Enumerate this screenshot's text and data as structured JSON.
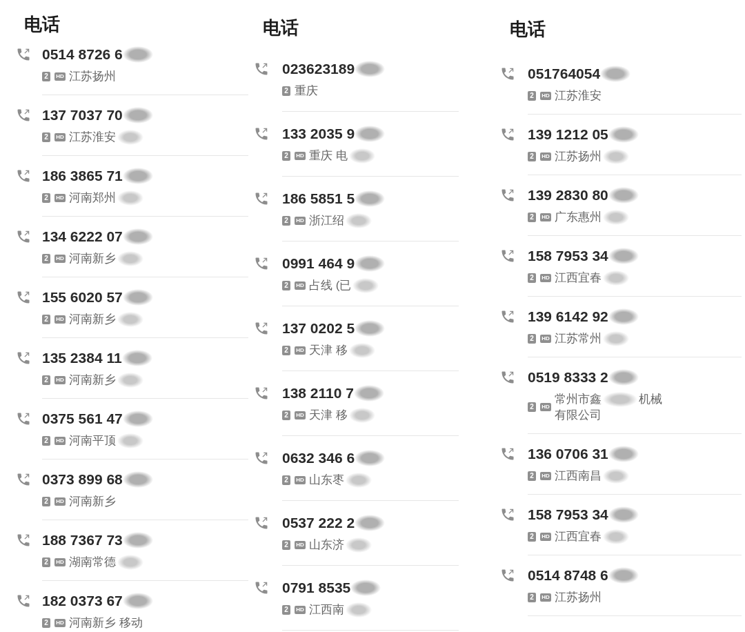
{
  "screens": [
    {
      "title": "电话",
      "calls": [
        {
          "number": "0514 8726 6",
          "number_blurred": true,
          "badges": [
            {
              "kind": "sim",
              "text": "2"
            },
            {
              "kind": "hd",
              "text": "HD"
            }
          ],
          "location": [
            [
              "江苏扬州"
            ]
          ],
          "location_blurred": false
        },
        {
          "number": "137 7037 70",
          "number_blurred": true,
          "badges": [
            {
              "kind": "sim",
              "text": "2"
            },
            {
              "kind": "hd",
              "text": "HD"
            }
          ],
          "location": [
            [
              "江苏淮安"
            ]
          ],
          "location_blurred": true
        },
        {
          "number": "186 3865 71",
          "number_blurred": true,
          "badges": [
            {
              "kind": "sim",
              "text": "2"
            },
            {
              "kind": "hd",
              "text": "HD"
            }
          ],
          "location": [
            [
              "河南郑州"
            ]
          ],
          "location_blurred": true
        },
        {
          "number": "134 6222 07",
          "number_blurred": true,
          "badges": [
            {
              "kind": "sim",
              "text": "2"
            },
            {
              "kind": "hd",
              "text": "HD"
            }
          ],
          "location": [
            [
              "河南新乡"
            ]
          ],
          "location_blurred": true
        },
        {
          "number": "155 6020 57",
          "number_blurred": true,
          "badges": [
            {
              "kind": "sim",
              "text": "2"
            },
            {
              "kind": "hd",
              "text": "HD"
            }
          ],
          "location": [
            [
              "河南新乡"
            ]
          ],
          "location_blurred": true
        },
        {
          "number": "135 2384 11",
          "number_blurred": true,
          "badges": [
            {
              "kind": "sim",
              "text": "2"
            },
            {
              "kind": "hd",
              "text": "HD"
            }
          ],
          "location": [
            [
              "河南新乡"
            ]
          ],
          "location_blurred": true
        },
        {
          "number": "0375 561 47",
          "number_blurred": true,
          "badges": [
            {
              "kind": "sim",
              "text": "2"
            },
            {
              "kind": "hd",
              "text": "HD"
            }
          ],
          "location": [
            [
              "河南平顶"
            ]
          ],
          "location_blurred": true
        },
        {
          "number": "0373 899 68",
          "number_blurred": true,
          "badges": [
            {
              "kind": "sim",
              "text": "2"
            },
            {
              "kind": "hd",
              "text": "HD"
            }
          ],
          "location": [
            [
              "河南新乡"
            ]
          ],
          "location_blurred": false
        },
        {
          "number": "188 7367 73",
          "number_blurred": true,
          "badges": [
            {
              "kind": "sim",
              "text": "2"
            },
            {
              "kind": "hd",
              "text": "HD"
            }
          ],
          "location": [
            [
              "湖南常德"
            ]
          ],
          "location_blurred": true
        },
        {
          "number": "182 0373 67",
          "number_blurred": true,
          "badges": [
            {
              "kind": "sim",
              "text": "2"
            },
            {
              "kind": "hd",
              "text": "HD"
            }
          ],
          "location": [
            [
              "河南新乡 移动"
            ]
          ],
          "location_blurred": false
        }
      ]
    },
    {
      "title": "电话",
      "calls": [
        {
          "number": "023623189",
          "number_blurred": true,
          "badges": [
            {
              "kind": "sim",
              "text": "2"
            }
          ],
          "location": [
            [
              "重庆"
            ]
          ],
          "location_blurred": false
        },
        {
          "number": "133 2035 9",
          "number_blurred": true,
          "badges": [
            {
              "kind": "sim",
              "text": "2"
            },
            {
              "kind": "hd",
              "text": "HD"
            }
          ],
          "location": [
            [
              "重庆 电"
            ]
          ],
          "location_blurred": true
        },
        {
          "number": "186 5851 5",
          "number_blurred": true,
          "badges": [
            {
              "kind": "sim",
              "text": "2"
            },
            {
              "kind": "hd",
              "text": "HD"
            }
          ],
          "location": [
            [
              "浙江绍"
            ]
          ],
          "location_blurred": true
        },
        {
          "number": "0991 464 9",
          "number_blurred": true,
          "badges": [
            {
              "kind": "sim",
              "text": "2"
            },
            {
              "kind": "hd",
              "text": "HD"
            }
          ],
          "location": [
            [
              "占线 (已"
            ]
          ],
          "location_blurred": true
        },
        {
          "number": "137 0202 5",
          "number_blurred": true,
          "badges": [
            {
              "kind": "sim",
              "text": "2"
            },
            {
              "kind": "hd",
              "text": "HD"
            }
          ],
          "location": [
            [
              "天津 移"
            ]
          ],
          "location_blurred": true
        },
        {
          "number": "138 2110 7",
          "number_blurred": true,
          "badges": [
            {
              "kind": "sim",
              "text": "2"
            },
            {
              "kind": "hd",
              "text": "HD"
            }
          ],
          "location": [
            [
              "天津 移"
            ]
          ],
          "location_blurred": true
        },
        {
          "number": "0632 346 6",
          "number_blurred": true,
          "badges": [
            {
              "kind": "sim",
              "text": "2"
            },
            {
              "kind": "hd",
              "text": "HD"
            }
          ],
          "location": [
            [
              "山东枣"
            ]
          ],
          "location_blurred": true
        },
        {
          "number": "0537 222 2",
          "number_blurred": true,
          "badges": [
            {
              "kind": "sim",
              "text": "2"
            },
            {
              "kind": "hd",
              "text": "HD"
            }
          ],
          "location": [
            [
              "山东济"
            ]
          ],
          "location_blurred": true
        },
        {
          "number": "0791 8535",
          "number_blurred": true,
          "badges": [
            {
              "kind": "sim",
              "text": "2"
            },
            {
              "kind": "hd",
              "text": "HD"
            }
          ],
          "location": [
            [
              "江西南"
            ]
          ],
          "location_blurred": true
        }
      ]
    },
    {
      "title": "电话",
      "calls": [
        {
          "number": "051764054",
          "number_blurred": true,
          "badges": [
            {
              "kind": "sim",
              "text": "2"
            },
            {
              "kind": "hd",
              "text": "HD"
            }
          ],
          "location": [
            [
              "江苏淮安"
            ]
          ],
          "location_blurred": false
        },
        {
          "number": "139 1212 05",
          "number_blurred": true,
          "badges": [
            {
              "kind": "sim",
              "text": "2"
            },
            {
              "kind": "hd",
              "text": "HD"
            }
          ],
          "location": [
            [
              "江苏扬州"
            ]
          ],
          "location_blurred": true
        },
        {
          "number": "139 2830 80",
          "number_blurred": true,
          "badges": [
            {
              "kind": "sim",
              "text": "2"
            },
            {
              "kind": "hd",
              "text": "HD"
            }
          ],
          "location": [
            [
              "广东惠州"
            ]
          ],
          "location_blurred": true
        },
        {
          "number": "158 7953 34",
          "number_blurred": true,
          "badges": [
            {
              "kind": "sim",
              "text": "2"
            },
            {
              "kind": "hd",
              "text": "HD"
            }
          ],
          "location": [
            [
              "江西宜春"
            ]
          ],
          "location_blurred": true
        },
        {
          "number": "139 6142 92",
          "number_blurred": true,
          "badges": [
            {
              "kind": "sim",
              "text": "2"
            },
            {
              "kind": "hd",
              "text": "HD"
            }
          ],
          "location": [
            [
              "江苏常州"
            ]
          ],
          "location_blurred": true
        },
        {
          "number": "0519 8333 2",
          "number_blurred": true,
          "badges": [
            {
              "kind": "sim",
              "text": "2"
            },
            {
              "kind": "hd",
              "text": "HD"
            }
          ],
          "location": [
            [
              "常州市鑫",
              "机械"
            ],
            [
              "有限公司"
            ]
          ],
          "location_blurred": false
        },
        {
          "number": "136 0706 31",
          "number_blurred": true,
          "badges": [
            {
              "kind": "sim",
              "text": "2"
            },
            {
              "kind": "hd",
              "text": "HD"
            }
          ],
          "location": [
            [
              "江西南昌"
            ]
          ],
          "location_blurred": true
        },
        {
          "number": "158 7953 34",
          "number_blurred": true,
          "badges": [
            {
              "kind": "sim",
              "text": "2"
            },
            {
              "kind": "hd",
              "text": "HD"
            }
          ],
          "location": [
            [
              "江西宜春"
            ]
          ],
          "location_blurred": true
        },
        {
          "number": "0514 8748 6",
          "number_blurred": true,
          "badges": [
            {
              "kind": "sim",
              "text": "2"
            },
            {
              "kind": "hd",
              "text": "HD"
            }
          ],
          "location": [
            [
              "江苏扬州"
            ]
          ],
          "location_blurred": false
        }
      ]
    }
  ]
}
